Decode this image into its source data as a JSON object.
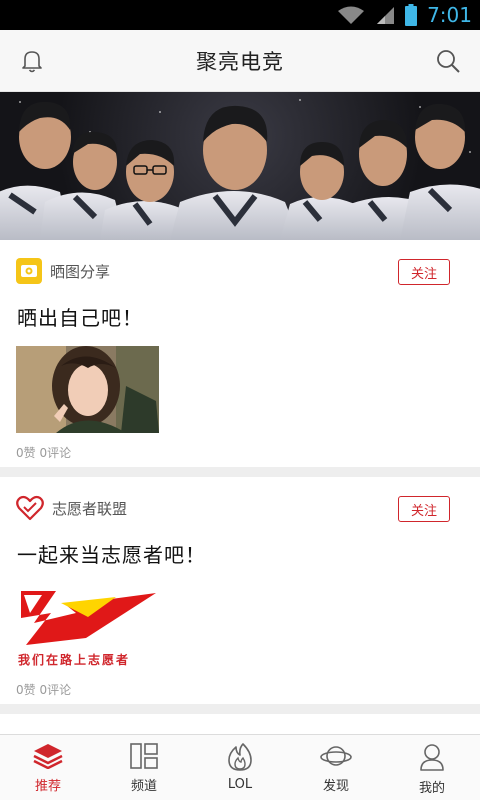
{
  "status_bar": {
    "time": "7:01"
  },
  "header": {
    "title": "聚亮电竞",
    "left_icon": "bell-icon",
    "right_icon": "search-icon"
  },
  "posts": [
    {
      "channel": "晒图分享",
      "channel_icon": "photo-share-icon",
      "follow_label": "关注",
      "title": "晒出自己吧！",
      "image": "selfie-photo",
      "stats": "0赞 0评论"
    },
    {
      "channel": "志愿者联盟",
      "channel_icon": "heart-icon",
      "follow_label": "关注",
      "title": "一起来当志愿者吧！",
      "image": "volunteer-logo",
      "image_caption": "我们在路上志愿者",
      "stats": "0赞 0评论"
    }
  ],
  "tabs": [
    {
      "label": "推荐",
      "icon": "layers-icon",
      "active": true
    },
    {
      "label": "频道",
      "icon": "grid-icon",
      "active": false
    },
    {
      "label": "LOL",
      "icon": "flame-icon",
      "active": false
    },
    {
      "label": "发现",
      "icon": "planet-icon",
      "active": false
    },
    {
      "label": "我的",
      "icon": "user-icon",
      "active": false
    }
  ],
  "colors": {
    "accent": "#d0262c",
    "status_time": "#3fb7e8",
    "channel_badge": "#f5c518"
  }
}
